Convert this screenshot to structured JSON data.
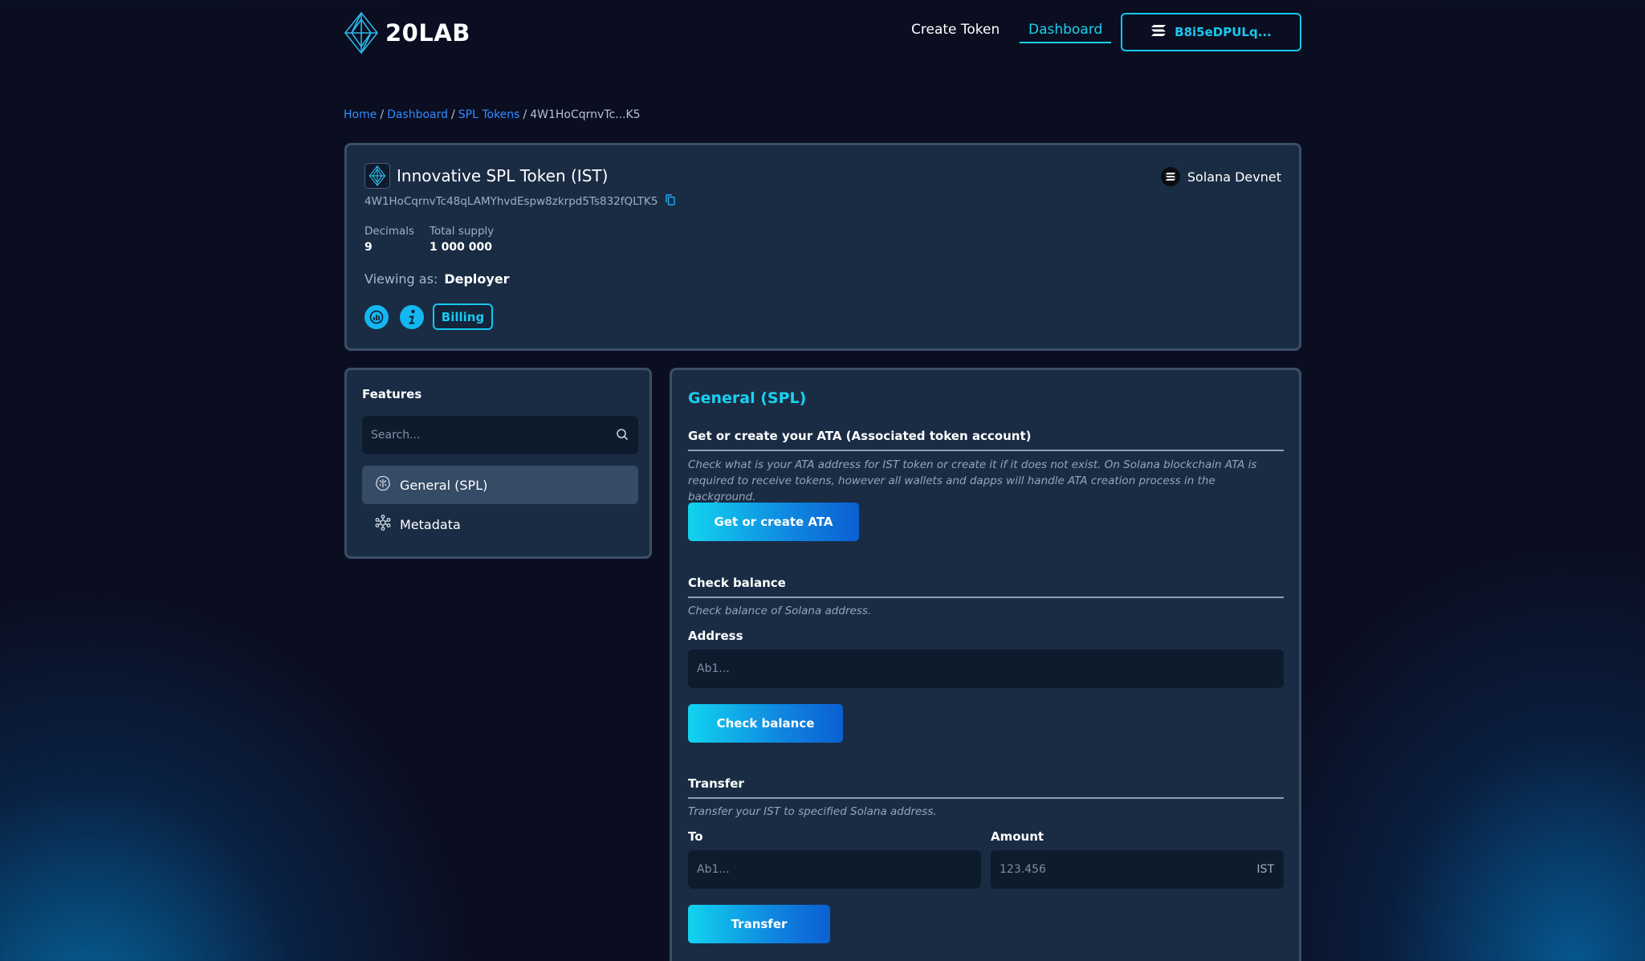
{
  "header": {
    "logo_text": "20LAB",
    "nav": {
      "create_token": "Create Token",
      "dashboard": "Dashboard"
    },
    "wallet_label": "B8i5eDPULq..."
  },
  "breadcrumb": {
    "home": "Home",
    "dashboard": "Dashboard",
    "spl_tokens": "SPL Tokens",
    "current": "4W1HoCqrnvTc...K5",
    "separator": "/"
  },
  "token": {
    "name": "Innovative SPL Token (IST)",
    "address": "4W1HoCqrnvTc48qLAMYhvdEspw8zkrpd5Ts832fQLTK5",
    "network": "Solana Devnet",
    "decimals_label": "Decimals",
    "decimals_value": "9",
    "supply_label": "Total supply",
    "supply_value": "1 000 000",
    "viewing_label": "Viewing as:",
    "viewing_role": "Deployer",
    "billing_label": "Billing"
  },
  "features": {
    "title": "Features",
    "search_placeholder": "Search...",
    "items": [
      {
        "label": "General (SPL)",
        "active": true
      },
      {
        "label": "Metadata",
        "active": false
      }
    ]
  },
  "main": {
    "title": "General (SPL)",
    "ata": {
      "heading": "Get or create your ATA (Associated token account)",
      "description": "Check what is your ATA address for IST token or create it if it does not exist. On Solana blockchain ATA is required to receive tokens, however all wallets and dapps will handle ATA creation process in the background.",
      "button": "Get or create ATA"
    },
    "balance": {
      "heading": "Check balance",
      "description": "Check balance of Solana address.",
      "address_label": "Address",
      "address_placeholder": "Ab1...",
      "button": "Check balance"
    },
    "transfer": {
      "heading": "Transfer",
      "description": "Transfer your IST to specified Solana address.",
      "to_label": "To",
      "to_placeholder": "Ab1...",
      "amount_label": "Amount",
      "amount_placeholder": "123.456",
      "amount_suffix": "IST",
      "button": "Transfer"
    }
  },
  "colors": {
    "accent": "#19d1ee",
    "link": "#2f8bff",
    "card_bg": "#1a2c44",
    "page_bg": "#0b0e21"
  }
}
